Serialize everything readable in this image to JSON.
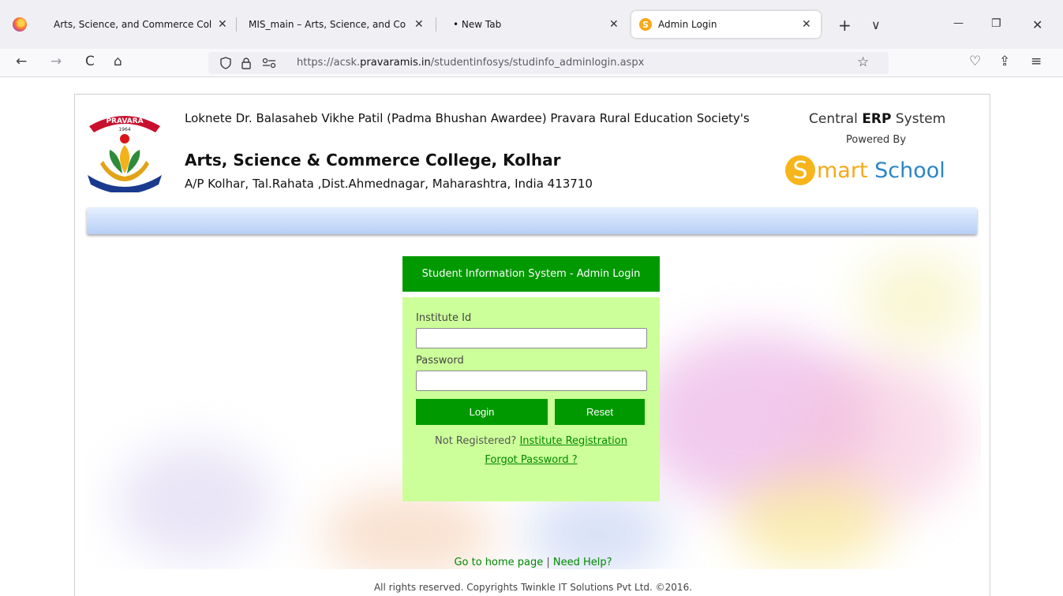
{
  "browser": {
    "tabs": [
      {
        "title": "Arts, Science, and Commerce Col",
        "close": "✕"
      },
      {
        "title": "MIS_main – Arts, Science, and Co",
        "close": "✕"
      },
      {
        "title": "• New Tab",
        "close": "✕"
      },
      {
        "title": "Admin Login",
        "close": "✕",
        "favicon": "S"
      }
    ],
    "new_tab": "+",
    "tab_list": "∨",
    "minimize": "—",
    "restore": "❐",
    "close": "✕",
    "back": "←",
    "forward": "→",
    "reload": "C",
    "home": "⌂",
    "url_prefix": "https://acsk.",
    "url_domain": "pravaramis.in",
    "url_path": "/studentinfosys/studinfo_adminlogin.aspx",
    "bookmark_star": "☆",
    "pocket": "♡",
    "extensions": "⇪",
    "menu": "≡"
  },
  "header": {
    "logo_ribbon": "PRAVARA",
    "logo_year": "1964",
    "society": "Loknete Dr. Balasaheb Vikhe Patil (Padma Bhushan Awardee) Pravara Rural Education Society's",
    "college": "Arts, Science & Commerce College, Kolhar",
    "address": "A/P Kolhar, Tal.Rahata ,Dist.Ahmednagar, Maharashtra, India 413710",
    "erp_prefix": "Central ",
    "erp_bold": "ERP",
    "erp_suffix": " System",
    "powered_by": "Powered By",
    "brand_s": "S",
    "brand_mart": "mart",
    "brand_school": " School"
  },
  "login": {
    "title": "Student Information System - Admin Login",
    "institute_label": "Institute Id",
    "institute_value": "",
    "password_label": "Password",
    "password_value": "",
    "login_button": "Login",
    "reset_button": "Reset",
    "not_registered": "Not Registered? ",
    "registration_link": "Institute Registration",
    "forgot_link": "Forgot Password ?"
  },
  "footer": {
    "home_link": "Go to home page",
    "separator": " | ",
    "help_link": "Need Help?",
    "copyright": "All rights reserved. Copyrights Twinkle IT Solutions Pvt Ltd. ©2016."
  },
  "colors": {
    "green": "#009900",
    "login_bg": "#ccff99",
    "link_green": "#008800",
    "brand_orange": "#f7a81b",
    "brand_blue": "#2a86c8"
  }
}
